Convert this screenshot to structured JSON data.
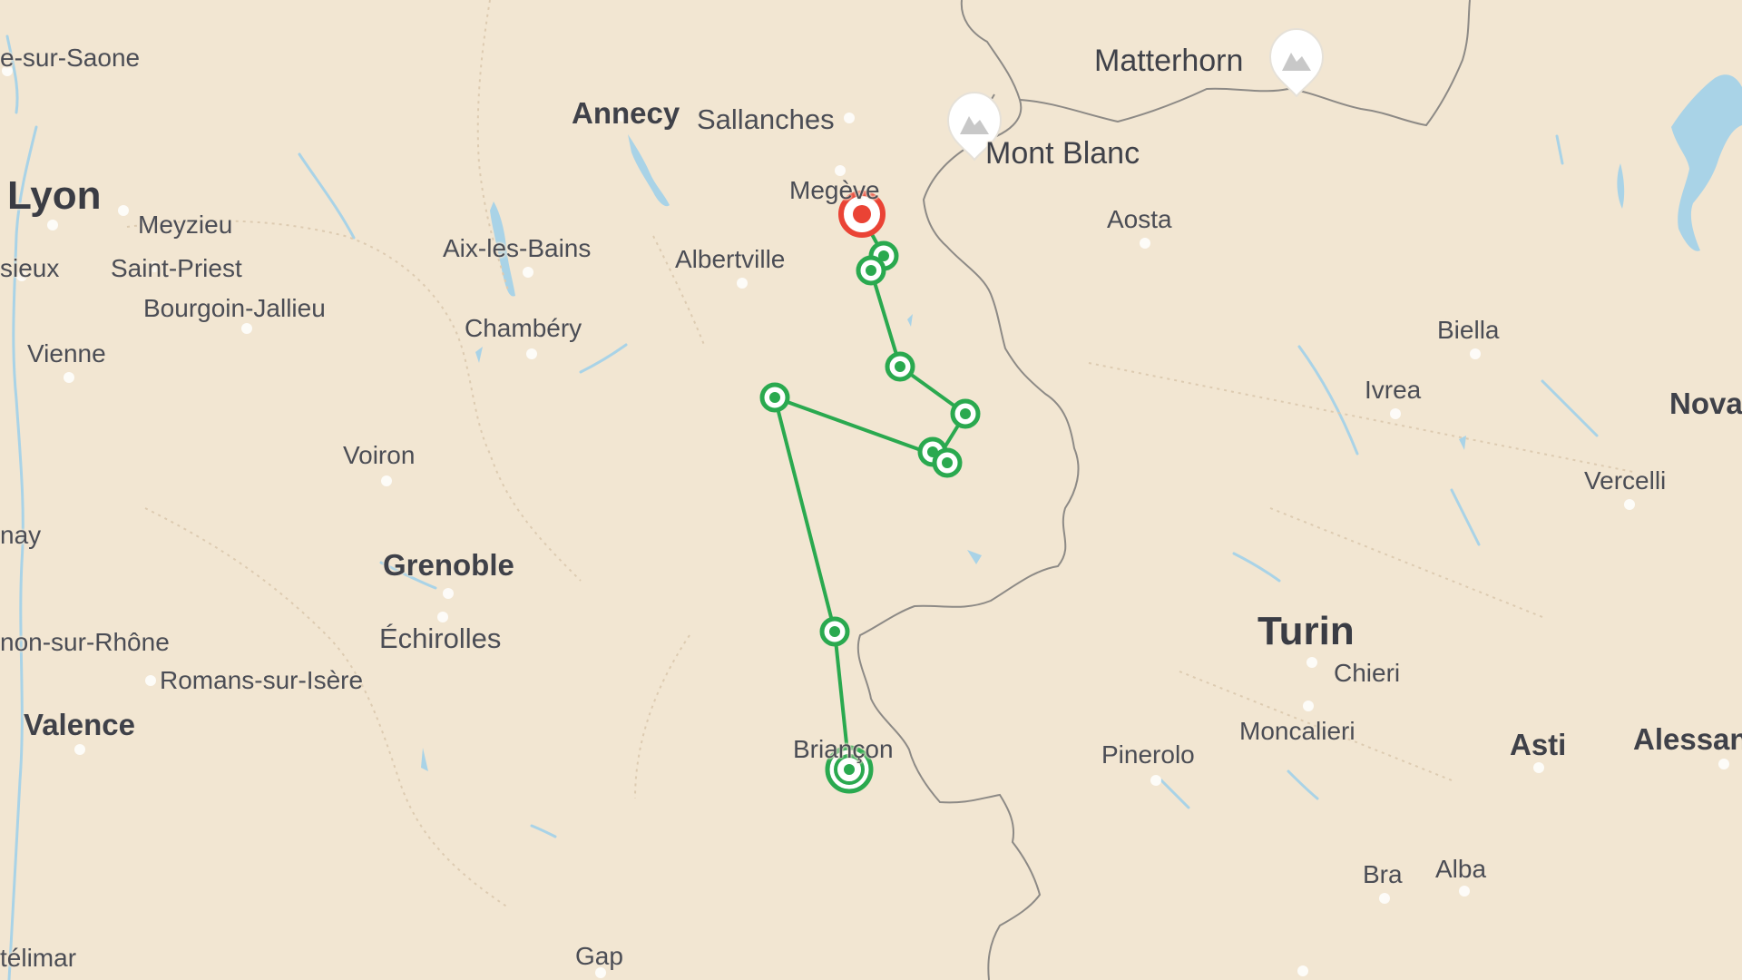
{
  "map": {
    "colors": {
      "land": "#f2e6d2",
      "water": "#a9d3e7",
      "border": "#8d8a86",
      "route": "#2aa94f",
      "start_marker": "#ea4335",
      "label": "#4b4d55"
    },
    "peaks": [
      {
        "name": "Matterhorn",
        "icon": "mountain-pin-icon"
      },
      {
        "name": "Mont Blanc",
        "icon": "mountain-pin-icon"
      }
    ],
    "places": {
      "chalon": "e-sur-Saone",
      "annecy": "Annecy",
      "sallanches": "Sallanches",
      "lyon": "Lyon",
      "meyzieu": "Meyzieu",
      "venissieux": "sieux",
      "saint_priest": "Saint-Priest",
      "bourgoin": "Bourgoin-Jallieu",
      "vienne": "Vienne",
      "aix": "Aix-les-Bains",
      "albertville": "Albertville",
      "megeve": "Megève",
      "chambery": "Chambéry",
      "aosta": "Aosta",
      "biella": "Biella",
      "ivrea": "Ivrea",
      "novara": "Nova",
      "vercelli": "Vercelli",
      "voiron": "Voiron",
      "grenoble": "Grenoble",
      "echirolles": "Échirolles",
      "tournon": "non-sur-Rhône",
      "romans": "Romans-sur-Isère",
      "valence": "Valence",
      "briancon": "Briançon",
      "pinerolo": "Pinerolo",
      "turin": "Turin",
      "chieri": "Chieri",
      "moncalieri": "Moncalieri",
      "asti": "Asti",
      "alessandria": "Alessan",
      "bra": "Bra",
      "alba": "Alba",
      "gap": "Gap",
      "montelimar": "télimar",
      "ay": "nay"
    },
    "route": {
      "start_marker": "start-marker-icon",
      "stop_marker": "route-stop-icon",
      "end_marker": "route-end-icon",
      "stop_count": 10
    }
  }
}
